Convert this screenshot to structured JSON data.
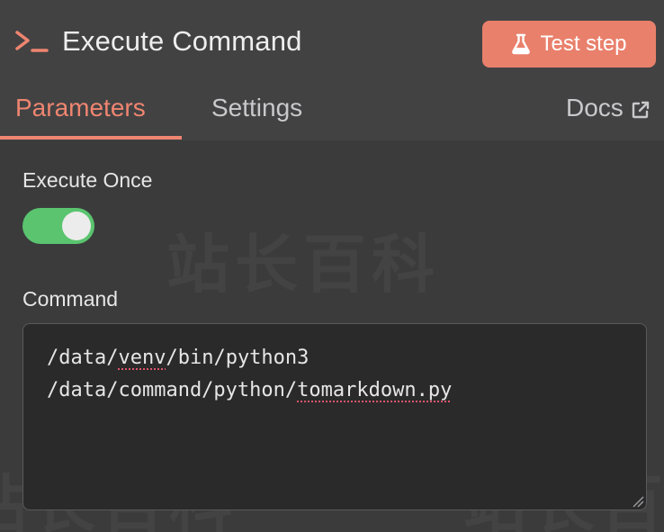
{
  "header": {
    "title": "Execute Command",
    "icon": "terminal-prompt-icon",
    "test_button_label": "Test step",
    "test_button_icon": "flask-icon"
  },
  "tabs": {
    "items": [
      {
        "label": "Parameters",
        "active": true
      },
      {
        "label": "Settings",
        "active": false
      }
    ],
    "docs_label": "Docs",
    "docs_icon": "external-link-icon"
  },
  "fields": {
    "execute_once": {
      "label": "Execute Once",
      "value": true
    },
    "command": {
      "label": "Command",
      "line1_prefix": "/data/",
      "line1_misspelled": "venv",
      "line1_suffix": "/bin/python3",
      "line2_prefix": "/data/command/python/",
      "line2_misspelled": "tomarkdown.py"
    }
  },
  "watermark": "站长百科",
  "colors": {
    "accent": "#ef8570",
    "button": "#e9806b",
    "toggle_on": "#5ac46f",
    "background": "#3b3b3c",
    "header_bg": "#424243",
    "input_bg": "#2a2a2b"
  }
}
